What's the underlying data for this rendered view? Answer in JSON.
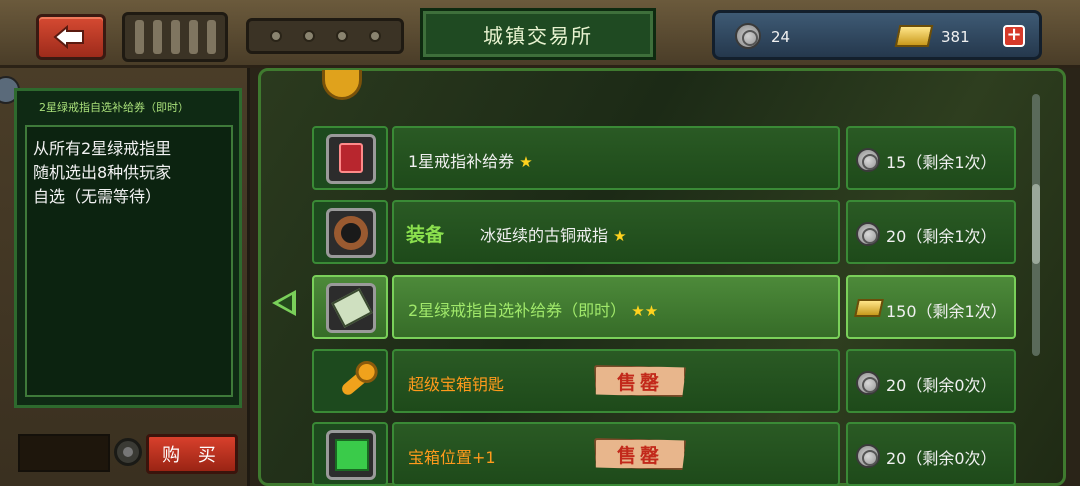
{
  "header": {
    "title": "城镇交易所",
    "coins": "24",
    "gems": "381",
    "add_label": "+"
  },
  "left_panel": {
    "item_title": "2星绿戒指自选补给券（即时）",
    "description": "从所有2星绿戒指里\n随机选出8种供玩家\n自选（无需等待）",
    "buy_label": "购 买"
  },
  "shop": {
    "items": [
      {
        "name": "1星戒指补给券",
        "stars": "★",
        "price": "15（剩余1次）",
        "currency": "coin",
        "icon": "red-ticket-icon"
      },
      {
        "tag": "装备",
        "name": "冰延续的古铜戒指",
        "stars": "★",
        "price": "20（剩余1次）",
        "currency": "coin",
        "icon": "bronze-ring-icon"
      },
      {
        "name": "2星绿戒指自选补给券（即时）",
        "stars": "★★",
        "price": "150（剩余1次）",
        "currency": "gold",
        "icon": "green-ticket-icon",
        "selected": true
      },
      {
        "name": "超级宝箱钥匙",
        "sold_label": "售罄",
        "price": "20（剩余0次）",
        "currency": "coin",
        "icon": "key-icon"
      },
      {
        "name": "宝箱位置+1",
        "sold_label": "售罄",
        "price": "20（剩余0次）",
        "currency": "coin",
        "icon": "map-icon"
      }
    ]
  },
  "colors": {
    "accent_green": "#3a8a36",
    "selected_green": "#7ad05a",
    "orange_text": "#ff9a1c",
    "sold_red": "#c2291b",
    "star_yellow": "#ffd21e"
  }
}
